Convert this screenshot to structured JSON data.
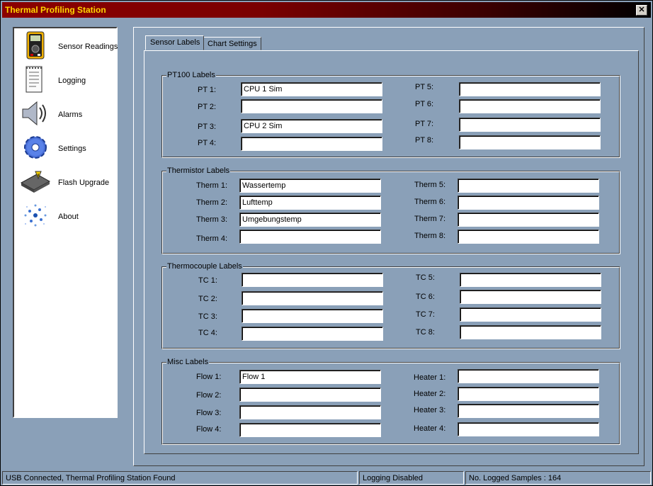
{
  "window": {
    "title": "Thermal Profiling Station",
    "close_glyph": "✕"
  },
  "nav": {
    "items": [
      {
        "label": "Sensor Readings",
        "icon": "multimeter-icon"
      },
      {
        "label": "Logging",
        "icon": "notepad-icon"
      },
      {
        "label": "Alarms",
        "icon": "speaker-icon"
      },
      {
        "label": "Settings",
        "icon": "gear-icon"
      },
      {
        "label": "Flash Upgrade",
        "icon": "chip-icon"
      },
      {
        "label": "About",
        "icon": "dots-icon"
      }
    ]
  },
  "tabs": [
    {
      "label": "Sensor Labels",
      "active": true
    },
    {
      "label": "Chart Settings",
      "active": false
    }
  ],
  "groups": {
    "pt100": {
      "title": "PT100 Labels",
      "left": [
        {
          "label": "PT 1:",
          "value": "CPU 1 Sim"
        },
        {
          "label": "PT 2:",
          "value": ""
        },
        {
          "label": "PT 3:",
          "value": "CPU 2 Sim"
        },
        {
          "label": "PT 4:",
          "value": ""
        }
      ],
      "right": [
        {
          "label": "PT 5:",
          "value": ""
        },
        {
          "label": "PT 6:",
          "value": ""
        },
        {
          "label": "PT 7:",
          "value": ""
        },
        {
          "label": "PT 8:",
          "value": ""
        }
      ]
    },
    "therm": {
      "title": "Thermistor Labels",
      "left": [
        {
          "label": "Therm 1:",
          "value": "Wassertemp"
        },
        {
          "label": "Therm 2:",
          "value": "Lufttemp"
        },
        {
          "label": "Therm 3:",
          "value": "Umgebungstemp"
        },
        {
          "label": "Therm 4:",
          "value": ""
        }
      ],
      "right": [
        {
          "label": "Therm 5:",
          "value": ""
        },
        {
          "label": "Therm 6:",
          "value": ""
        },
        {
          "label": "Therm 7:",
          "value": ""
        },
        {
          "label": "Therm 8:",
          "value": ""
        }
      ]
    },
    "tc": {
      "title": "Thermocouple Labels",
      "left": [
        {
          "label": "TC 1:",
          "value": ""
        },
        {
          "label": "TC 2:",
          "value": ""
        },
        {
          "label": "TC 3:",
          "value": ""
        },
        {
          "label": "TC 4:",
          "value": ""
        }
      ],
      "right": [
        {
          "label": "TC 5:",
          "value": ""
        },
        {
          "label": "TC 6:",
          "value": ""
        },
        {
          "label": "TC 7:",
          "value": ""
        },
        {
          "label": "TC 8:",
          "value": ""
        }
      ]
    },
    "misc": {
      "title": "Misc Labels",
      "left": [
        {
          "label": "Flow 1:",
          "value": "Flow 1"
        },
        {
          "label": "Flow 2:",
          "value": ""
        },
        {
          "label": "Flow 3:",
          "value": ""
        },
        {
          "label": "Flow 4:",
          "value": ""
        }
      ],
      "right": [
        {
          "label": "Heater 1:",
          "value": ""
        },
        {
          "label": "Heater 2:",
          "value": ""
        },
        {
          "label": "Heater 3:",
          "value": ""
        },
        {
          "label": "Heater 4:",
          "value": ""
        }
      ]
    }
  },
  "status": {
    "connection": "USB Connected, Thermal Profiling Station Found",
    "logging": "Logging Disabled",
    "samples": "No. Logged Samples : 164"
  },
  "colors": {
    "window_bg": "#8aa0b8",
    "title_text": "#ffd700",
    "title_bar": "#8b0000"
  }
}
